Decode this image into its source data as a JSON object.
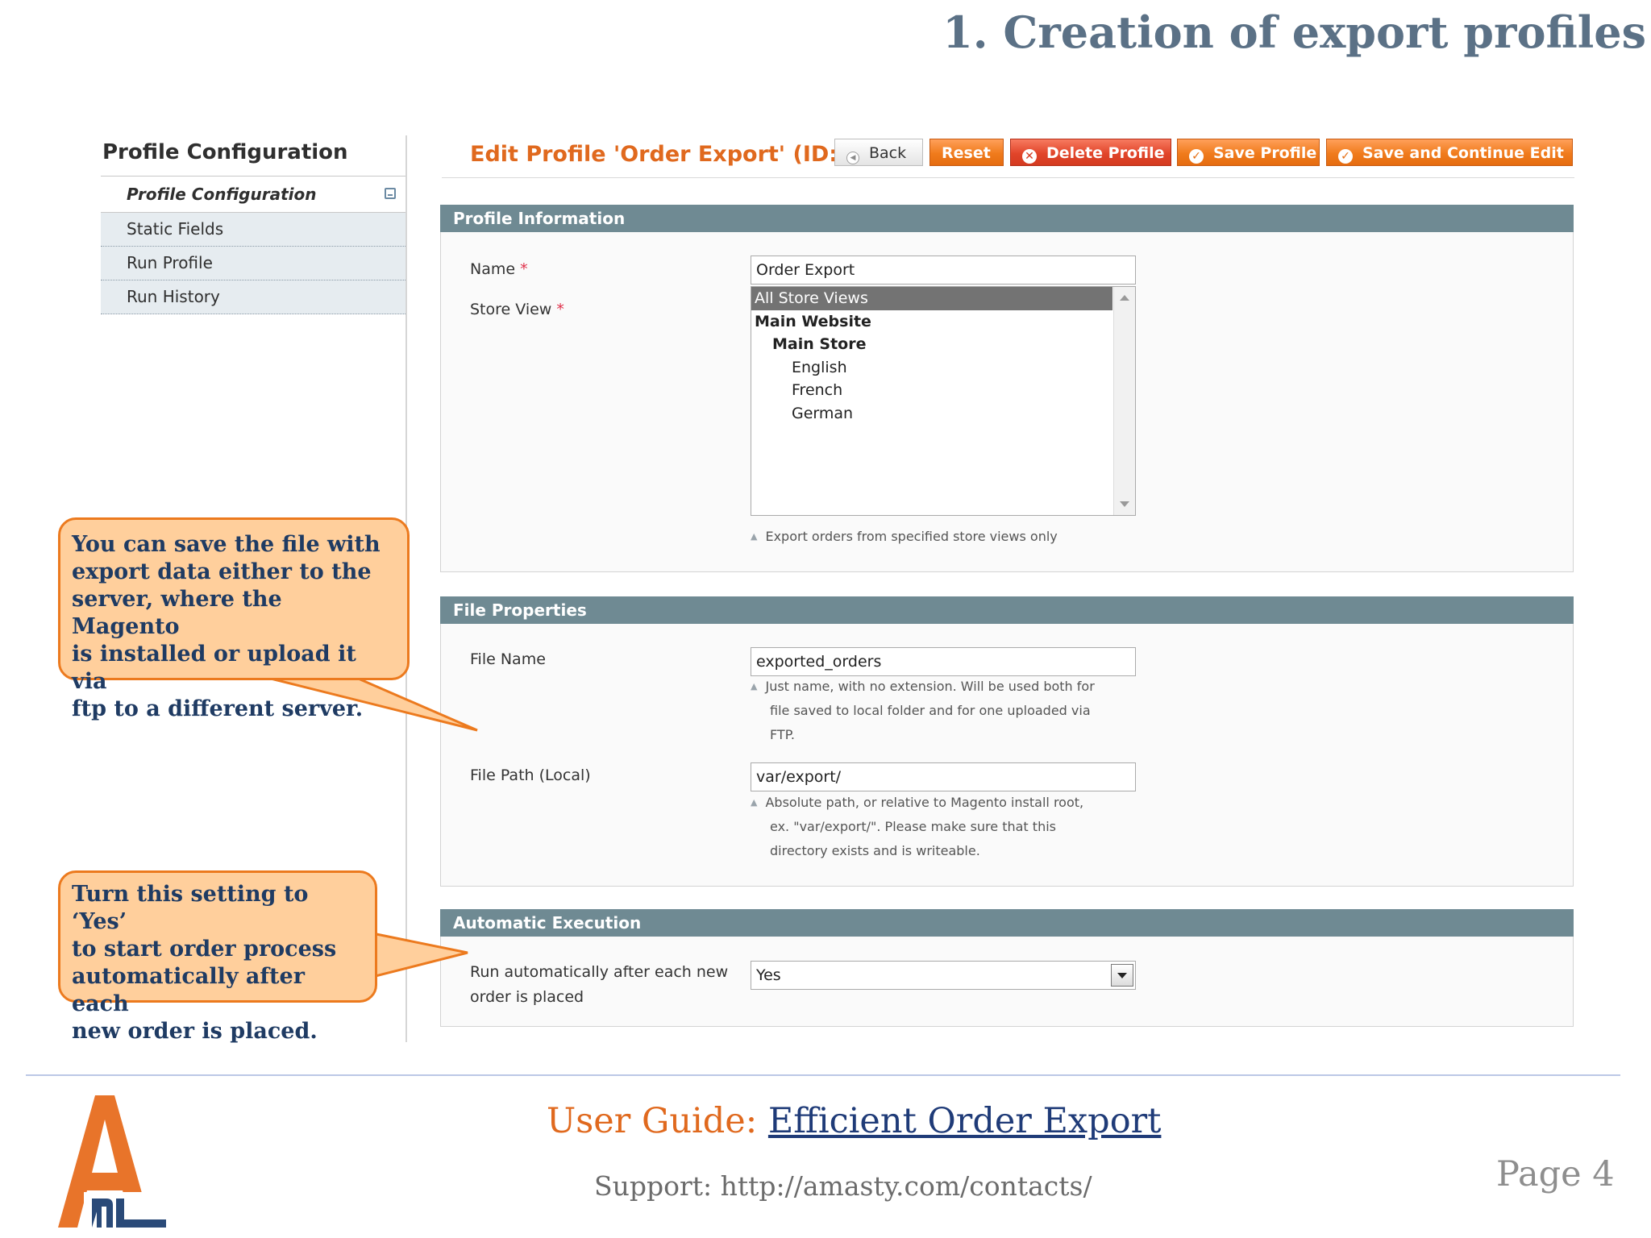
{
  "page": {
    "heading": "1. Creation of export profiles",
    "footer": {
      "guide_prefix": "User Guide: ",
      "guide_link": "Efficient Order Export",
      "support": "Support: http://amasty.com/contacts/",
      "page_label": "Page 4"
    }
  },
  "sidebar": {
    "title": "Profile Configuration",
    "items": [
      {
        "label": "Profile Configuration",
        "active": true
      },
      {
        "label": "Static Fields"
      },
      {
        "label": "Run Profile"
      },
      {
        "label": "Run History"
      }
    ]
  },
  "toolbar": {
    "title": "Edit Profile 'Order Export' (ID: 1)",
    "back_label": "Back",
    "reset_label": "Reset",
    "delete_label": "Delete Profile",
    "save_label": "Save Profile",
    "save_continue_label": "Save and Continue Edit"
  },
  "profile_info": {
    "header": "Profile Information",
    "name_label": "Name",
    "required_mark": "*",
    "name_value": "Order Export",
    "store_view_label": "Store View",
    "store_options": [
      "All Store Views",
      "Main Website",
      "Main Store",
      "English",
      "French",
      "German"
    ],
    "store_note": "Export orders from specified store views only"
  },
  "file_properties": {
    "header": "File Properties",
    "file_name_label": "File Name",
    "file_name_value": "exported_orders",
    "file_name_note_lines": [
      "Just name, with no extension. Will be used both for",
      "file saved to local folder and for one uploaded via",
      "FTP."
    ],
    "file_path_label": "File Path (Local)",
    "file_path_value": "var/export/",
    "file_path_note_lines": [
      "Absolute path, or relative to Magento install root,",
      "ex. \"var/export/\". Please make sure that this",
      "directory exists and is writeable."
    ]
  },
  "automatic_execution": {
    "header": "Automatic Execution",
    "run_label_lines": [
      "Run automatically after each new",
      "order is placed"
    ],
    "run_value": "Yes"
  },
  "callouts": {
    "file_lines": [
      "You can save the file with",
      "export data either to the",
      "server, where the Magento",
      "is installed or upload it via",
      "ftp to a different server."
    ],
    "setting_lines": [
      "Turn this setting to ‘Yes’",
      "to start order process",
      "automatically after each",
      "new order is placed."
    ]
  },
  "colors": {
    "accent_orange": "#e0691e",
    "section_header": "#6f8a93",
    "callout_fill": "#ffcf9c",
    "callout_border": "#ec7a1e",
    "callout_text": "#1f3b63",
    "heading": "#5b7186"
  },
  "icons": {
    "back": "back-arrow-icon",
    "delete": "delete-circle-icon",
    "save": "check-circle-icon",
    "sidebar_active": "save-disk-icon",
    "logo": "amasty-logo"
  }
}
